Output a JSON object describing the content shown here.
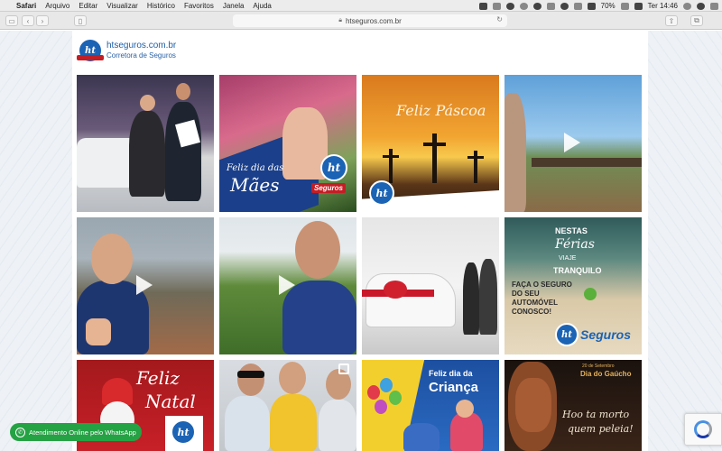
{
  "menubar": {
    "app": "Safari",
    "items": [
      "Arquivo",
      "Editar",
      "Visualizar",
      "Histórico",
      "Favoritos",
      "Janela",
      "Ajuda"
    ],
    "battery": "70%",
    "clock": "Ter 14:46"
  },
  "toolbar": {
    "url": "htseguros.com.br"
  },
  "header": {
    "site_name": "htseguros.com.br",
    "site_sub": "Corretora de Seguros",
    "logo_text": "ht"
  },
  "tiles": {
    "t2": {
      "line1": "Feliz dia das",
      "line2": "Mães",
      "brand": "Seguros"
    },
    "t3": {
      "title": "Feliz Páscoa"
    },
    "t9": {
      "l1": "NESTAS",
      "l2": "Férias",
      "l3": "VIAJE",
      "l4": "TRANQUILO",
      "l5": "FAÇA O SEGURO",
      "l6": "DO SEU",
      "l7": "AUTOMÓVEL",
      "l8": "CONOSCO!",
      "brand": "Seguros"
    },
    "t13": {
      "l1": "Feliz",
      "l2": "Natal"
    },
    "t15": {
      "l1": "Feliz dia da",
      "l2": "Criança"
    },
    "t16": {
      "l1": "20 de Setembro",
      "l2": "Dia do Gaúcho",
      "l3": "Hoo ta morto",
      "l4": "quem peleia!"
    }
  },
  "whatsapp": {
    "label": "Atendimento Online pelo WhatsApp"
  },
  "colors": {
    "brand_blue": "#1b63b4",
    "brand_red": "#c41e25",
    "whatsapp_green": "#25a244"
  }
}
